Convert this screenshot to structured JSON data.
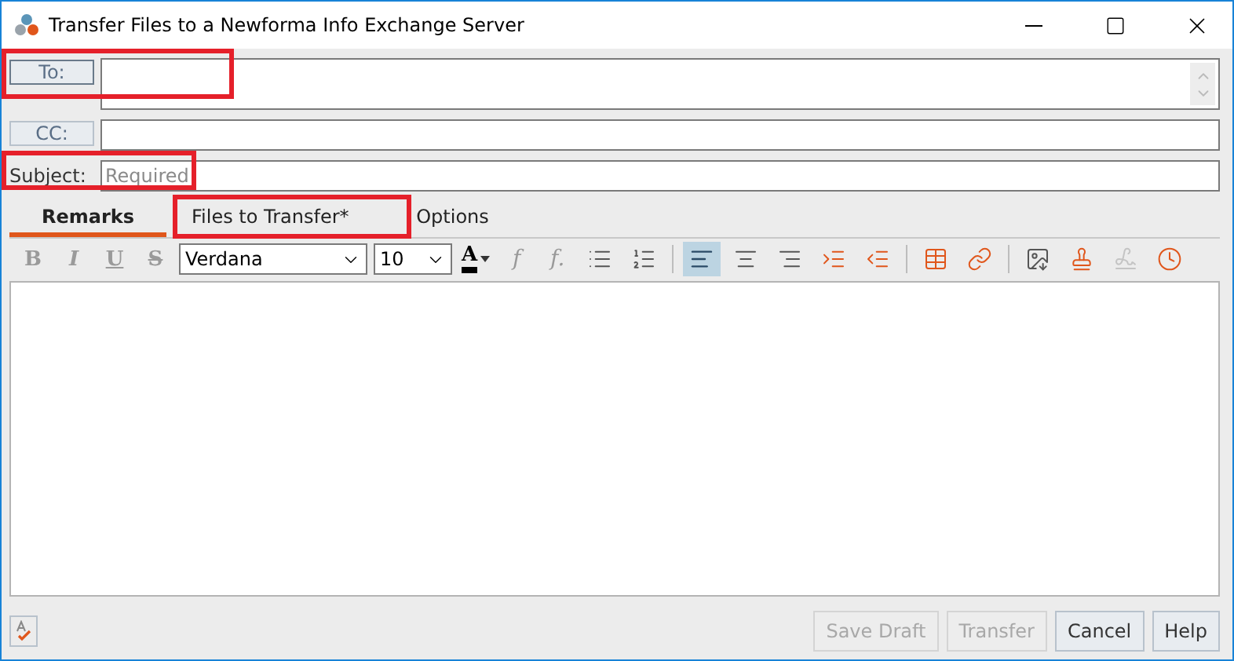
{
  "window": {
    "title": "Transfer Files to a Newforma Info Exchange Server"
  },
  "fields": [
    {
      "kind": "address",
      "label": "To:",
      "highlighted": true
    },
    {
      "kind": "address-single",
      "label": "CC:",
      "highlighted": false
    },
    {
      "kind": "text",
      "label": "Subject:",
      "placeholder": "Required",
      "highlighted": true
    }
  ],
  "tabs": [
    {
      "label": "Remarks",
      "selected": true,
      "highlighted": false
    },
    {
      "label": "Files to Transfer*",
      "selected": false,
      "highlighted": true
    },
    {
      "label": "Options",
      "selected": false,
      "highlighted": false
    }
  ],
  "format_buttons": [
    {
      "kind": "bold",
      "label": "B",
      "disabled": true
    },
    {
      "kind": "italic",
      "label": "I",
      "disabled": true
    },
    {
      "kind": "underline",
      "label": "U",
      "disabled": true
    },
    {
      "kind": "strike",
      "label": "S",
      "disabled": true
    }
  ],
  "font": {
    "value": "Verdana"
  },
  "size": {
    "value": "10"
  },
  "color_button": {
    "label": "A"
  },
  "function_buttons": [
    {
      "label": "f"
    },
    {
      "label": "f."
    }
  ],
  "tools": [
    {
      "kind": "bullets",
      "selected": false,
      "disabled": false
    },
    {
      "kind": "numbers",
      "selected": false,
      "disabled": false
    },
    {
      "kind": "separator"
    },
    {
      "kind": "align-left",
      "selected": true,
      "disabled": false
    },
    {
      "kind": "align-center",
      "selected": false,
      "disabled": false
    },
    {
      "kind": "align-right",
      "selected": false,
      "disabled": false
    },
    {
      "kind": "indent",
      "selected": false,
      "disabled": false
    },
    {
      "kind": "outdent",
      "selected": false,
      "disabled": false
    },
    {
      "kind": "separator"
    },
    {
      "kind": "table",
      "selected": false,
      "disabled": false
    },
    {
      "kind": "link",
      "selected": false,
      "disabled": false
    },
    {
      "kind": "separator"
    },
    {
      "kind": "image",
      "selected": false,
      "disabled": false
    },
    {
      "kind": "stamp",
      "selected": false,
      "disabled": false
    },
    {
      "kind": "signature",
      "selected": false,
      "disabled": true
    },
    {
      "kind": "timestamp",
      "selected": false,
      "disabled": false
    }
  ],
  "buttons": [
    {
      "label": "Save Draft",
      "disabled": true
    },
    {
      "label": "Transfer",
      "disabled": true
    },
    {
      "label": "Cancel",
      "disabled": false
    },
    {
      "label": "Help",
      "disabled": false
    }
  ]
}
